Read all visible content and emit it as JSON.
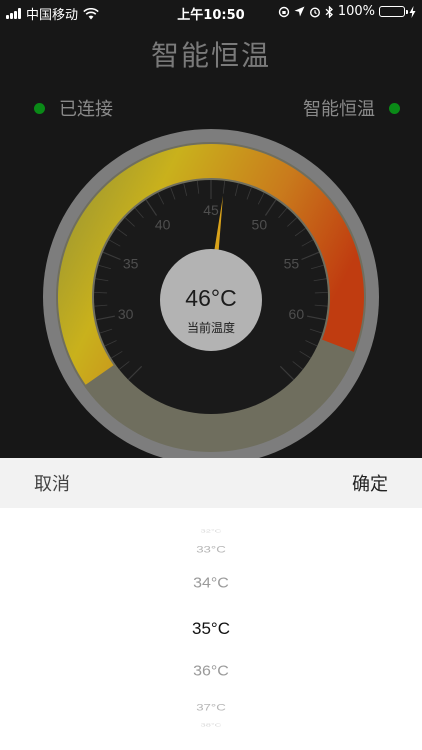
{
  "status_bar": {
    "carrier": "中国移动",
    "time": "上午10:50",
    "battery": "100%",
    "battery_level": 1.0
  },
  "header": {
    "title": "智能恒温"
  },
  "connection": {
    "left_label": "已连接",
    "right_label": "智能恒温",
    "dot_color": "#0a8a17"
  },
  "gauge": {
    "min": 25,
    "max": 65,
    "value": 46,
    "readout": "46°C",
    "readout_label": "当前温度",
    "tick_labels": [
      "30",
      "35",
      "40",
      "45",
      "50",
      "55",
      "60"
    ],
    "gradient": [
      "#8f8f38",
      "#c9b11c",
      "#c97a1c",
      "#c03c10"
    ]
  },
  "picker": {
    "cancel": "取消",
    "confirm": "确定",
    "options": [
      "32°C",
      "33°C",
      "34°C",
      "35°C",
      "36°C",
      "37°C",
      "38°C"
    ],
    "selected_index": 3
  }
}
